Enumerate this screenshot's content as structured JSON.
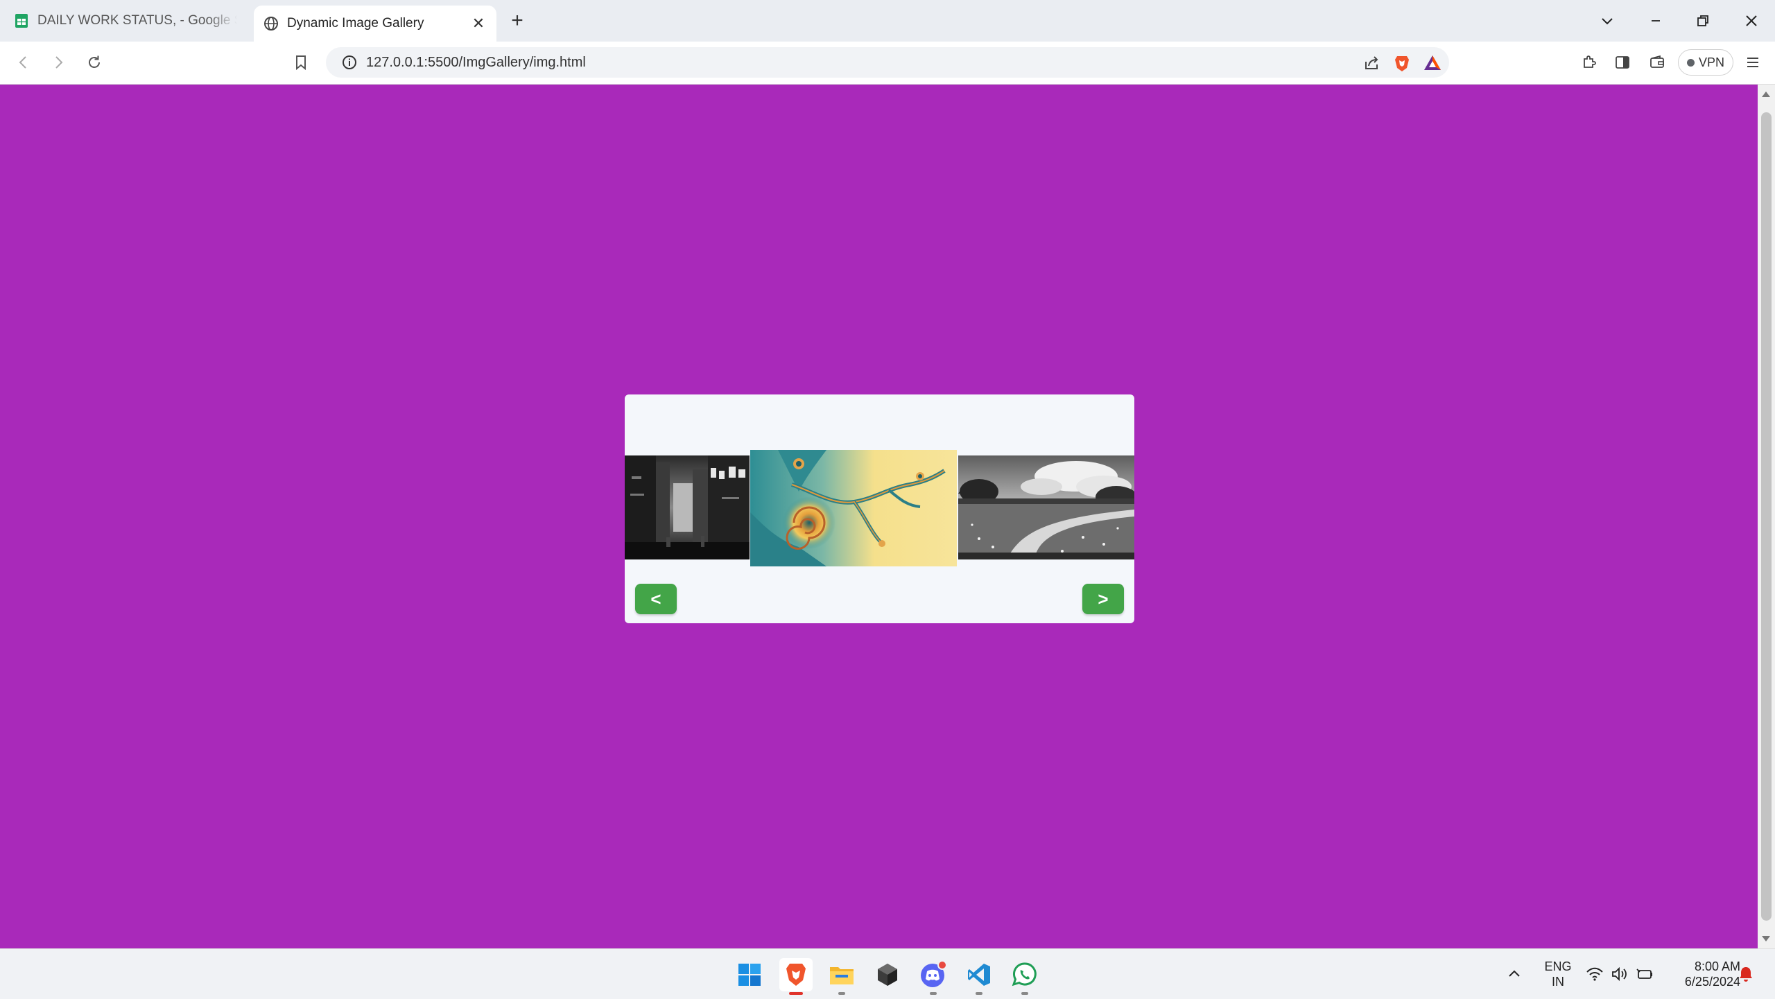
{
  "browser": {
    "tabs": [
      {
        "title": "DAILY WORK STATUS, - Google Shee",
        "icon": "google-sheets-icon",
        "active": false
      },
      {
        "title": "Dynamic Image Gallery",
        "icon": "globe-icon",
        "active": true
      }
    ],
    "url": "127.0.0.1:5500/ImgGallery/img.html",
    "vpn_label": "VPN"
  },
  "page": {
    "background_color": "#a929ba",
    "gallery": {
      "card_color": "#f4f7fb",
      "images": [
        {
          "name": "city-street-bw",
          "position": "left"
        },
        {
          "name": "fractal-spiral",
          "position": "center"
        },
        {
          "name": "landscape-field-bw",
          "position": "right"
        }
      ],
      "prev_label": "<",
      "next_label": ">",
      "button_color": "#43a548"
    }
  },
  "taskbar": {
    "apps": [
      "windows-start-icon",
      "brave-browser-icon",
      "file-explorer-icon",
      "unity-icon",
      "discord-icon",
      "vscode-icon",
      "whatsapp-icon"
    ],
    "lang_line1": "ENG",
    "lang_line2": "IN",
    "time": "8:00 AM",
    "date": "6/25/2024"
  }
}
